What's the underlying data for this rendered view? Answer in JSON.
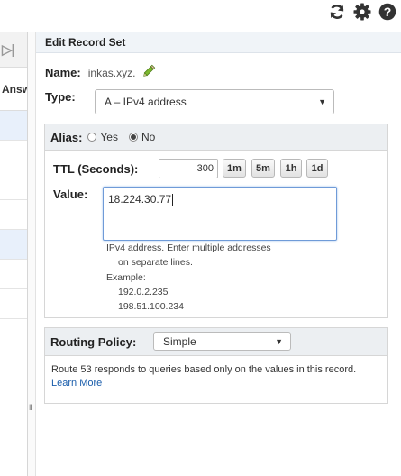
{
  "toolbar": {
    "icons": [
      "refresh-icon",
      "settings-icon",
      "help-icon"
    ]
  },
  "left_list": {
    "nav_glyph": "▷|",
    "column_header": "Answ"
  },
  "panel": {
    "title": "Edit Record Set"
  },
  "name": {
    "label": "Name:",
    "value": "inkas.xyz."
  },
  "type": {
    "label": "Type:",
    "selected": "A – IPv4 address"
  },
  "alias": {
    "label": "Alias:",
    "option_yes": "Yes",
    "option_no": "No",
    "selected": "No"
  },
  "ttl": {
    "label": "TTL (Seconds):",
    "value": "300",
    "buttons": [
      "1m",
      "5m",
      "1h",
      "1d"
    ]
  },
  "value_field": {
    "label": "Value:",
    "value": "18.224.30.77",
    "help_line1": "IPv4 address. Enter multiple addresses",
    "help_line2": "on separate lines.",
    "example_label": "Example:",
    "example_1": "192.0.2.235",
    "example_2": "198.51.100.234"
  },
  "routing": {
    "label": "Routing Policy:",
    "selected": "Simple",
    "description": "Route 53 responds to queries based only on the values in this record.",
    "learn_more": "Learn More"
  },
  "colors": {
    "accent": "#1a5dab",
    "panel_header": "#f0f4f8",
    "section_header": "#eceff2"
  }
}
